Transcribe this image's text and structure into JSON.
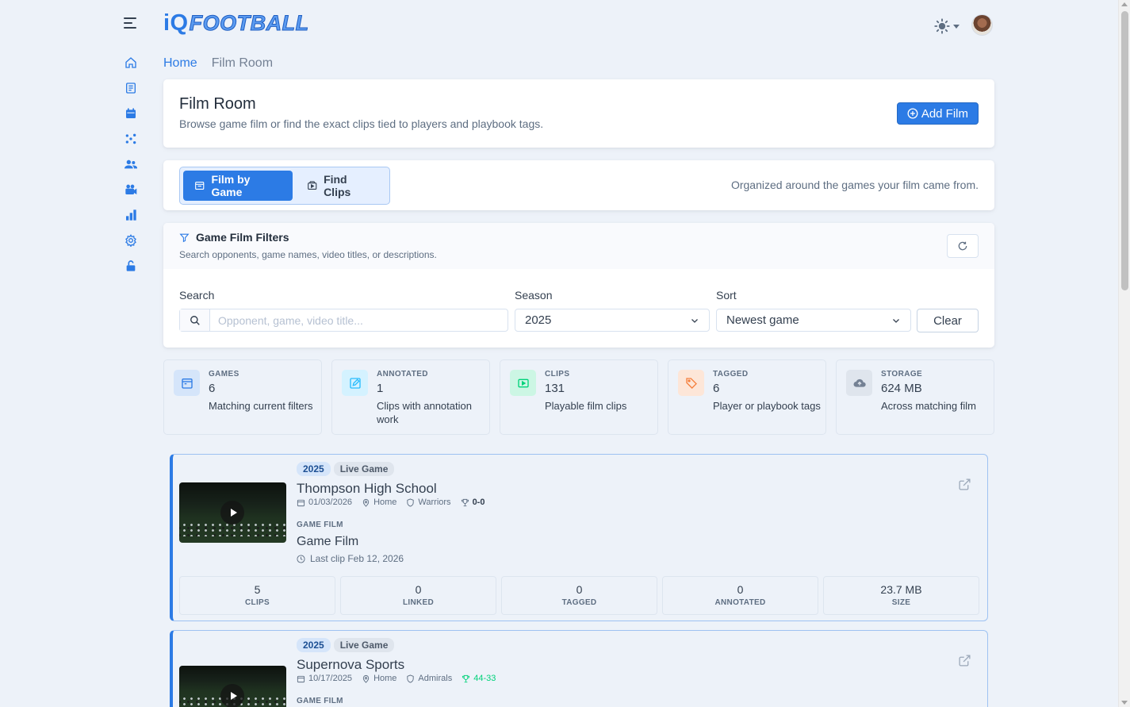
{
  "app": {
    "logo_prefix": "iQ",
    "logo_word": "FOOTBALL"
  },
  "breadcrumb": {
    "home": "Home",
    "current": "Film Room"
  },
  "header": {
    "title": "Film Room",
    "subtitle": "Browse game film or find the exact clips tied to players and playbook tags.",
    "add_label": "Add Film"
  },
  "tabs": {
    "items": [
      {
        "label": "Film by Game",
        "active": true
      },
      {
        "label": "Find Clips",
        "active": false
      }
    ],
    "note": "Organized around the games your film came from."
  },
  "filters": {
    "title": "Game Film Filters",
    "subtitle": "Search opponents, game names, video titles, or descriptions.",
    "search_label": "Search",
    "search_placeholder": "Opponent, game, video title...",
    "season_label": "Season",
    "season_value": "2025",
    "sort_label": "Sort",
    "sort_value": "Newest game",
    "clear_label": "Clear"
  },
  "stats": [
    {
      "label": "GAMES",
      "value": "6",
      "desc": "Matching current filters",
      "icon": "calendar-icon",
      "color": "#2c7be5",
      "bg": "#d5e5fa"
    },
    {
      "label": "ANNOTATED",
      "value": "1",
      "desc": "Clips with annotation work",
      "icon": "edit-icon",
      "color": "#27bcfd",
      "bg": "#d4f2ff"
    },
    {
      "label": "CLIPS",
      "value": "131",
      "desc": "Playable film clips",
      "icon": "video-icon",
      "color": "#00d27a",
      "bg": "#ccf6e4"
    },
    {
      "label": "TAGGED",
      "value": "6",
      "desc": "Player or playbook tags",
      "icon": "tag-icon",
      "color": "#f5803e",
      "bg": "#fde6d8"
    },
    {
      "label": "STORAGE",
      "value": "624 MB",
      "desc": "Across matching film",
      "icon": "cloud-icon",
      "color": "#748194",
      "bg": "#dfe5ed"
    }
  ],
  "games": [
    {
      "season": "2025",
      "type": "Live Game",
      "opponent": "Thompson High School",
      "date": "01/03/2026",
      "location": "Home",
      "team": "Warriors",
      "record": "0-0",
      "record_win": false,
      "section": "GAME FILM",
      "film_title": "Game Film",
      "last_clip": "Last clip Feb 12, 2026",
      "stats": [
        {
          "value": "5",
          "label": "CLIPS"
        },
        {
          "value": "0",
          "label": "LINKED"
        },
        {
          "value": "0",
          "label": "TAGGED"
        },
        {
          "value": "0",
          "label": "ANNOTATED"
        },
        {
          "value": "23.7 MB",
          "label": "SIZE"
        }
      ]
    },
    {
      "season": "2025",
      "type": "Live Game",
      "opponent": "Supernova Sports",
      "date": "10/17/2025",
      "location": "Home",
      "team": "Admirals",
      "record": "44-33",
      "record_win": true,
      "section": "GAME FILM"
    }
  ]
}
